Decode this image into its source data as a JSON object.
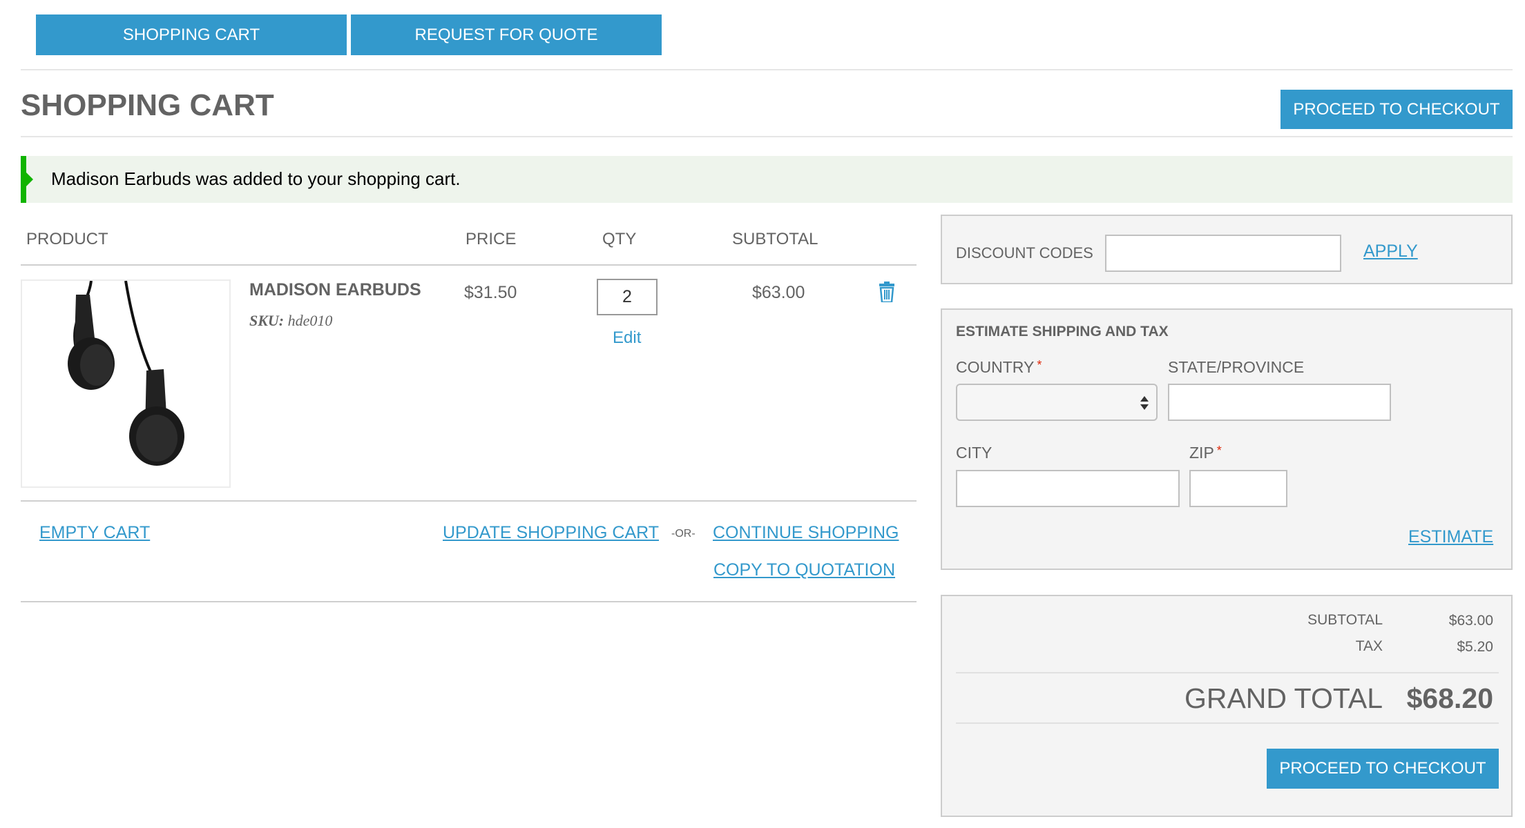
{
  "top_tabs": {
    "cart": "SHOPPING CART",
    "quote": "REQUEST FOR QUOTE"
  },
  "page": {
    "title": "SHOPPING CART",
    "checkout_top": "PROCEED TO CHECKOUT"
  },
  "message": "Madison Earbuds was added to your shopping cart.",
  "table": {
    "headers": {
      "product": "PRODUCT",
      "price": "PRICE",
      "qty": "QTY",
      "subtotal": "SUBTOTAL"
    },
    "item": {
      "name": "MADISON EARBUDS",
      "sku_label": "SKU:",
      "sku": "hde010",
      "price": "$31.50",
      "qty": "2",
      "edit": "Edit",
      "subtotal": "$63.00"
    }
  },
  "actions": {
    "empty": "EMPTY CART",
    "update": "UPDATE SHOPPING CART",
    "or": "-OR-",
    "continue": "CONTINUE SHOPPING",
    "copy": "COPY TO QUOTATION"
  },
  "discount": {
    "label": "DISCOUNT CODES",
    "value": "",
    "apply": "APPLY"
  },
  "shipping": {
    "title": "ESTIMATE SHIPPING AND TAX",
    "country": "COUNTRY",
    "state": "STATE/PROVINCE",
    "city": "CITY",
    "zip": "ZIP",
    "required_mark": "*",
    "estimate": "ESTIMATE"
  },
  "totals": {
    "subtotal_label": "SUBTOTAL",
    "subtotal": "$63.00",
    "tax_label": "TAX",
    "tax": "$5.20",
    "grand_label": "GRAND TOTAL",
    "grand": "$68.20",
    "checkout": "PROCEED TO CHECKOUT"
  },
  "colors": {
    "accent": "#3399cc",
    "success_bar": "#11b400",
    "success_bg": "#eef4ec",
    "required": "#df280a"
  }
}
